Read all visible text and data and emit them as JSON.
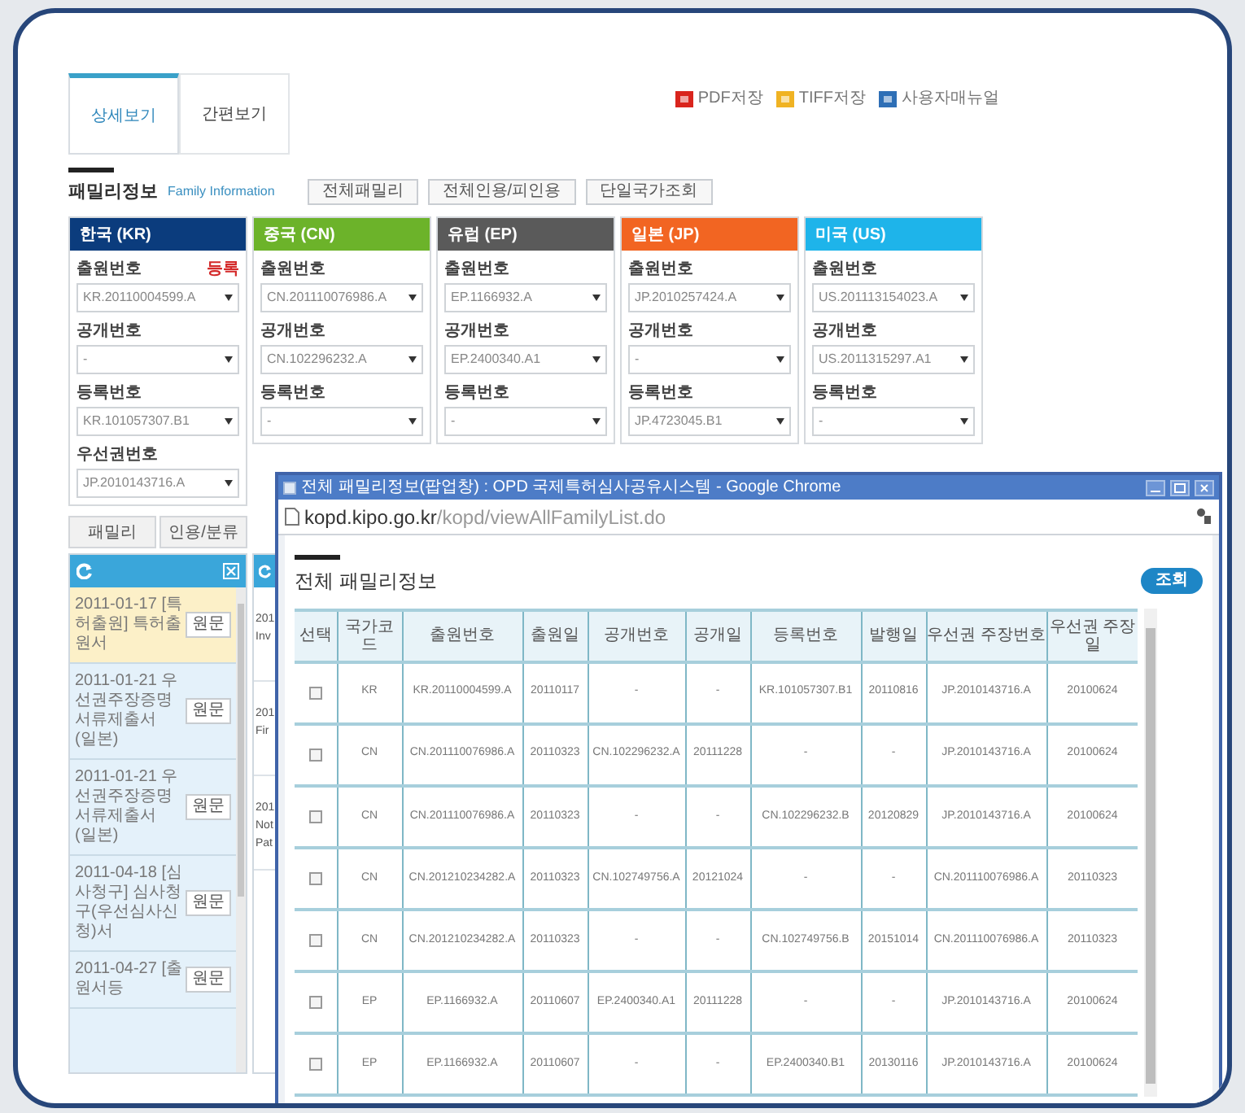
{
  "tabs": [
    {
      "label": "상세보기",
      "selected": true
    },
    {
      "label": "간편보기",
      "selected": false
    }
  ],
  "downloads": [
    {
      "kind": "pdf",
      "label": "PDF저장"
    },
    {
      "kind": "tiff",
      "label": "TIFF저장"
    },
    {
      "kind": "manual",
      "label": "사용자매뉴얼"
    }
  ],
  "family_section": {
    "title": "패밀리정보",
    "subtitle": "Family Information",
    "buttons": [
      "전체패밀리",
      "전체인용/피인용",
      "단일국가조회"
    ]
  },
  "countries": [
    {
      "name": "한국 (KR)",
      "color": "#0b3c7d",
      "badge": "등록",
      "fields": [
        {
          "label": "출원번호",
          "value": "KR.20110004599.A"
        },
        {
          "label": "공개번호",
          "value": "-"
        },
        {
          "label": "등록번호",
          "value": "KR.101057307.B1"
        },
        {
          "label": "우선권번호",
          "value": "JP.2010143716.A"
        }
      ]
    },
    {
      "name": "중국 (CN)",
      "color": "#6cb32a",
      "fields": [
        {
          "label": "출원번호",
          "value": "CN.201110076986.A"
        },
        {
          "label": "공개번호",
          "value": "CN.102296232.A"
        },
        {
          "label": "등록번호",
          "value": "-"
        }
      ]
    },
    {
      "name": "유럽 (EP)",
      "color": "#5a5a5a",
      "fields": [
        {
          "label": "출원번호",
          "value": "EP.1166932.A"
        },
        {
          "label": "공개번호",
          "value": "EP.2400340.A1"
        },
        {
          "label": "등록번호",
          "value": "-"
        }
      ]
    },
    {
      "name": "일본 (JP)",
      "color": "#f26522",
      "fields": [
        {
          "label": "출원번호",
          "value": "JP.2010257424.A"
        },
        {
          "label": "공개번호",
          "value": "-"
        },
        {
          "label": "등록번호",
          "value": "JP.4723045.B1"
        }
      ]
    },
    {
      "name": "미국 (US)",
      "color": "#1eb4ea",
      "fields": [
        {
          "label": "출원번호",
          "value": "US.201113154023.A"
        },
        {
          "label": "공개번호",
          "value": "US.2011315297.A1"
        },
        {
          "label": "등록번호",
          "value": "-"
        }
      ]
    }
  ],
  "bottom_buttons": [
    "패밀리",
    "인용/분류"
  ],
  "history_panel": {
    "items": [
      {
        "text": "2011-01-17 [특허출원] 특허출원서",
        "button": "원문",
        "selected": true
      },
      {
        "text": "2011-01-21 우선권주장증명서류제출서 (일본)",
        "button": "원문",
        "selected": false
      },
      {
        "text": "2011-01-21 우선권주장증명서류제출서 (일본)",
        "button": "원문",
        "selected": false
      },
      {
        "text": "2011-04-18 [심사청구] 심사청구(우선심사신청)서",
        "button": "원문",
        "selected": false
      },
      {
        "text": "2011-04-27 [출원서등",
        "button": "원문",
        "selected": false
      }
    ]
  },
  "second_panel": {
    "items": [
      {
        "lines": [
          "201",
          "Inv"
        ]
      },
      {
        "lines": [
          "201",
          "Fir"
        ]
      },
      {
        "lines": [
          "201",
          "Not",
          "Pat"
        ]
      }
    ]
  },
  "popup": {
    "title": "전체 패밀리정보(팝업창) : OPD 국제특허심사공유시스템 - Google Chrome",
    "url_host": "kopd.kipo.go.kr",
    "url_path": "/kopd/viewAllFamilyList.do",
    "heading": "전체 패밀리정보",
    "search_button": "조회",
    "columns": [
      "선택",
      "국가코드",
      "출원번호",
      "출원일",
      "공개번호",
      "공개일",
      "등록번호",
      "발행일",
      "우선권 주장번호",
      "우선권 주장일"
    ],
    "rows": [
      {
        "selected": false,
        "cells": [
          "",
          "KR",
          "KR.20110004599.A",
          "20110117",
          "-",
          "-",
          "KR.101057307.B1",
          "20110816",
          "JP.2010143716.A",
          "20100624"
        ]
      },
      {
        "selected": false,
        "cells": [
          "",
          "CN",
          "CN.201110076986.A",
          "20110323",
          "CN.102296232.A",
          "20111228",
          "-",
          "-",
          "JP.2010143716.A",
          "20100624"
        ]
      },
      {
        "selected": false,
        "cells": [
          "",
          "CN",
          "CN.201110076986.A",
          "20110323",
          "-",
          "-",
          "CN.102296232.B",
          "20120829",
          "JP.2010143716.A",
          "20100624"
        ]
      },
      {
        "selected": false,
        "cells": [
          "",
          "CN",
          "CN.201210234282.A",
          "20110323",
          "CN.102749756.A",
          "20121024",
          "-",
          "-",
          "CN.201110076986.A",
          "20110323"
        ]
      },
      {
        "selected": false,
        "cells": [
          "",
          "CN",
          "CN.201210234282.A",
          "20110323",
          "-",
          "-",
          "CN.102749756.B",
          "20151014",
          "CN.201110076986.A",
          "20110323"
        ]
      },
      {
        "selected": false,
        "cells": [
          "",
          "EP",
          "EP.1166932.A",
          "20110607",
          "EP.2400340.A1",
          "20111228",
          "-",
          "-",
          "JP.2010143716.A",
          "20100624"
        ]
      },
      {
        "selected": false,
        "cells": [
          "",
          "EP",
          "EP.1166932.A",
          "20110607",
          "-",
          "-",
          "EP.2400340.B1",
          "20130116",
          "JP.2010143716.A",
          "20100624"
        ]
      }
    ]
  }
}
